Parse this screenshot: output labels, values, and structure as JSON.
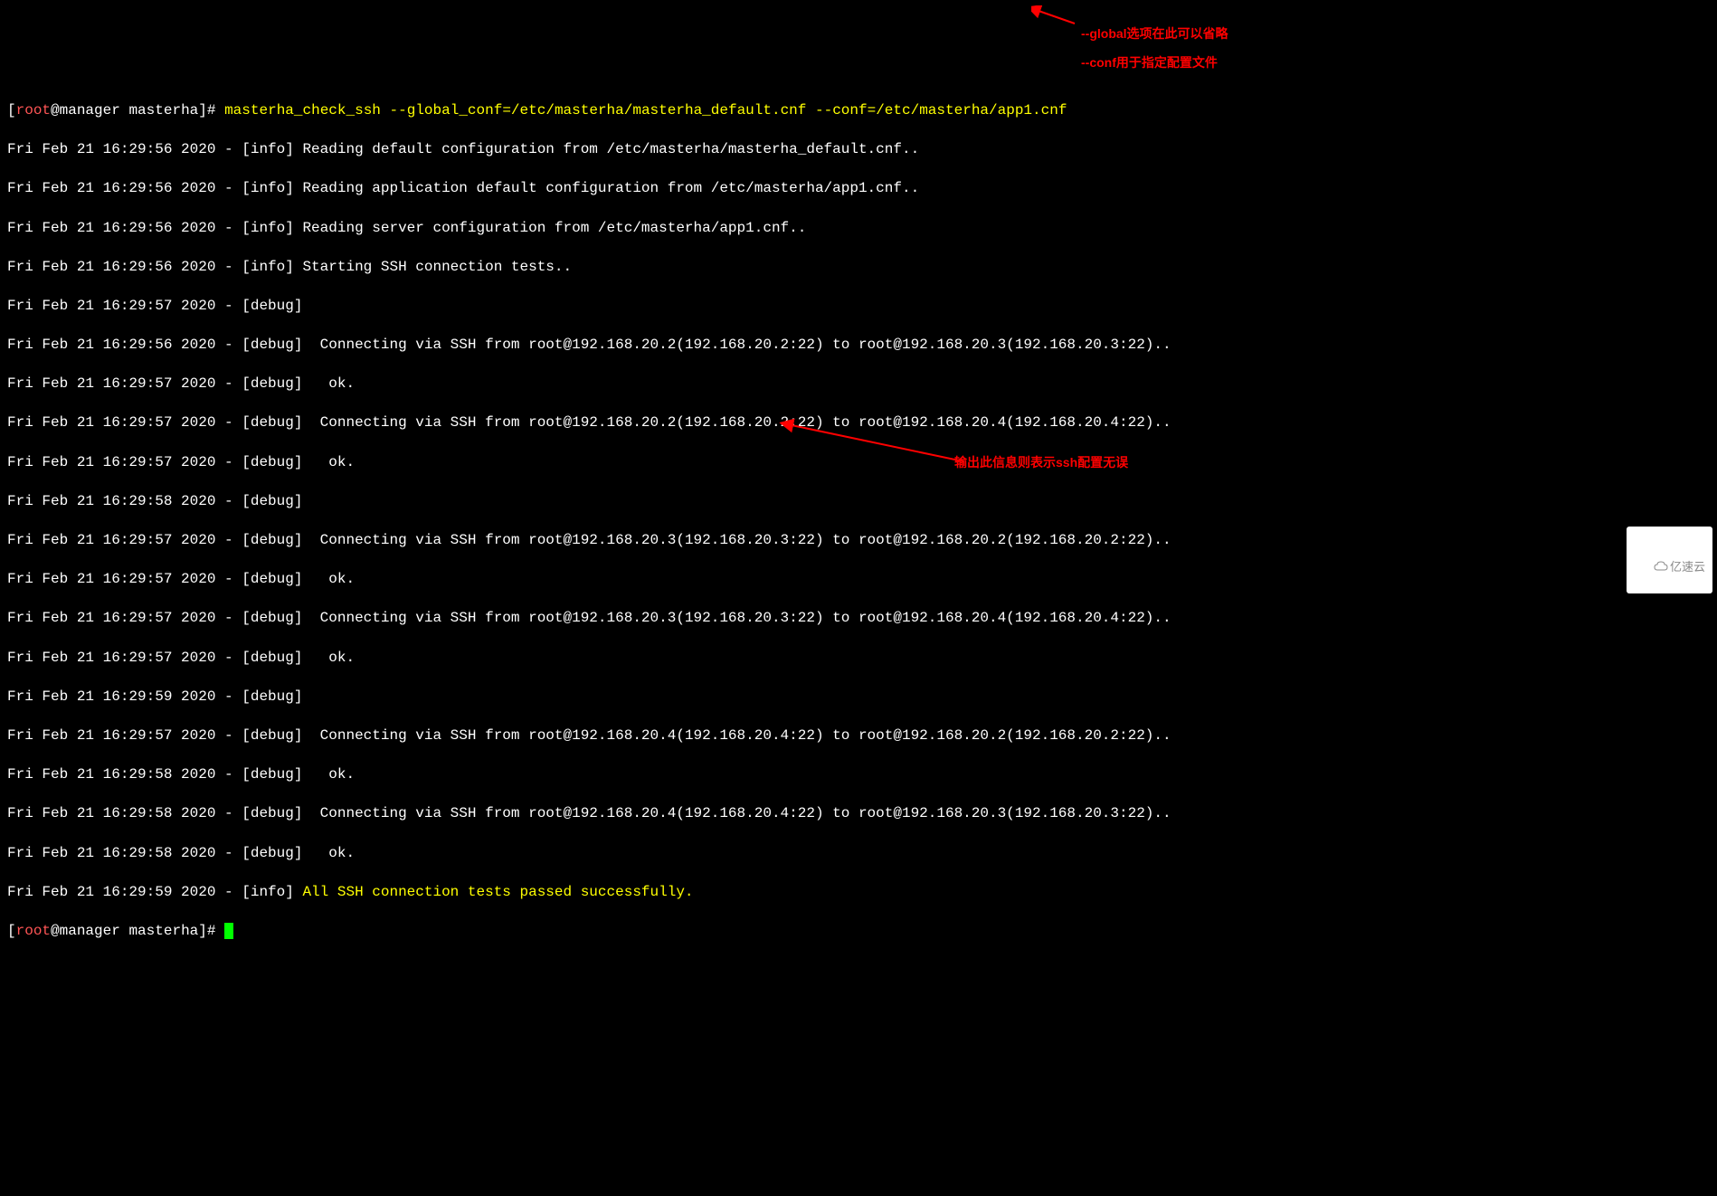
{
  "prompt": {
    "user": "root",
    "at": "@",
    "host": "manager",
    "path": "masterha",
    "open": "[",
    "close": "]#",
    "space": " "
  },
  "command": "masterha_check_ssh --global_conf=/etc/masterha/masterha_default.cnf --conf=/etc/masterha/app1.cnf",
  "lines": [
    "Fri Feb 21 16:29:56 2020 - [info] Reading default configuration from /etc/masterha/masterha_default.cnf..",
    "Fri Feb 21 16:29:56 2020 - [info] Reading application default configuration from /etc/masterha/app1.cnf..",
    "Fri Feb 21 16:29:56 2020 - [info] Reading server configuration from /etc/masterha/app1.cnf..",
    "Fri Feb 21 16:29:56 2020 - [info] Starting SSH connection tests..",
    "Fri Feb 21 16:29:57 2020 - [debug] ",
    "Fri Feb 21 16:29:56 2020 - [debug]  Connecting via SSH from root@192.168.20.2(192.168.20.2:22) to root@192.168.20.3(192.168.20.3:22)..",
    "Fri Feb 21 16:29:57 2020 - [debug]   ok.",
    "Fri Feb 21 16:29:57 2020 - [debug]  Connecting via SSH from root@192.168.20.2(192.168.20.2:22) to root@192.168.20.4(192.168.20.4:22)..",
    "Fri Feb 21 16:29:57 2020 - [debug]   ok.",
    "Fri Feb 21 16:29:58 2020 - [debug] ",
    "Fri Feb 21 16:29:57 2020 - [debug]  Connecting via SSH from root@192.168.20.3(192.168.20.3:22) to root@192.168.20.2(192.168.20.2:22)..",
    "Fri Feb 21 16:29:57 2020 - [debug]   ok.",
    "Fri Feb 21 16:29:57 2020 - [debug]  Connecting via SSH from root@192.168.20.3(192.168.20.3:22) to root@192.168.20.4(192.168.20.4:22)..",
    "Fri Feb 21 16:29:57 2020 - [debug]   ok.",
    "Fri Feb 21 16:29:59 2020 - [debug] ",
    "Fri Feb 21 16:29:57 2020 - [debug]  Connecting via SSH from root@192.168.20.4(192.168.20.4:22) to root@192.168.20.2(192.168.20.2:22)..",
    "Fri Feb 21 16:29:58 2020 - [debug]   ok.",
    "Fri Feb 21 16:29:58 2020 - [debug]  Connecting via SSH from root@192.168.20.4(192.168.20.4:22) to root@192.168.20.3(192.168.20.3:22)..",
    "Fri Feb 21 16:29:58 2020 - [debug]   ok."
  ],
  "success_line": {
    "prefix": "Fri Feb 21 16:29:59 2020 - [info] ",
    "msg": "All SSH connection tests passed successfully."
  },
  "annotations": {
    "a1": "--global选项在此可以省略",
    "a2": "--conf用于指定配置文件",
    "a3": "输出此信息则表示ssh配置无误"
  },
  "watermark": "亿速云"
}
